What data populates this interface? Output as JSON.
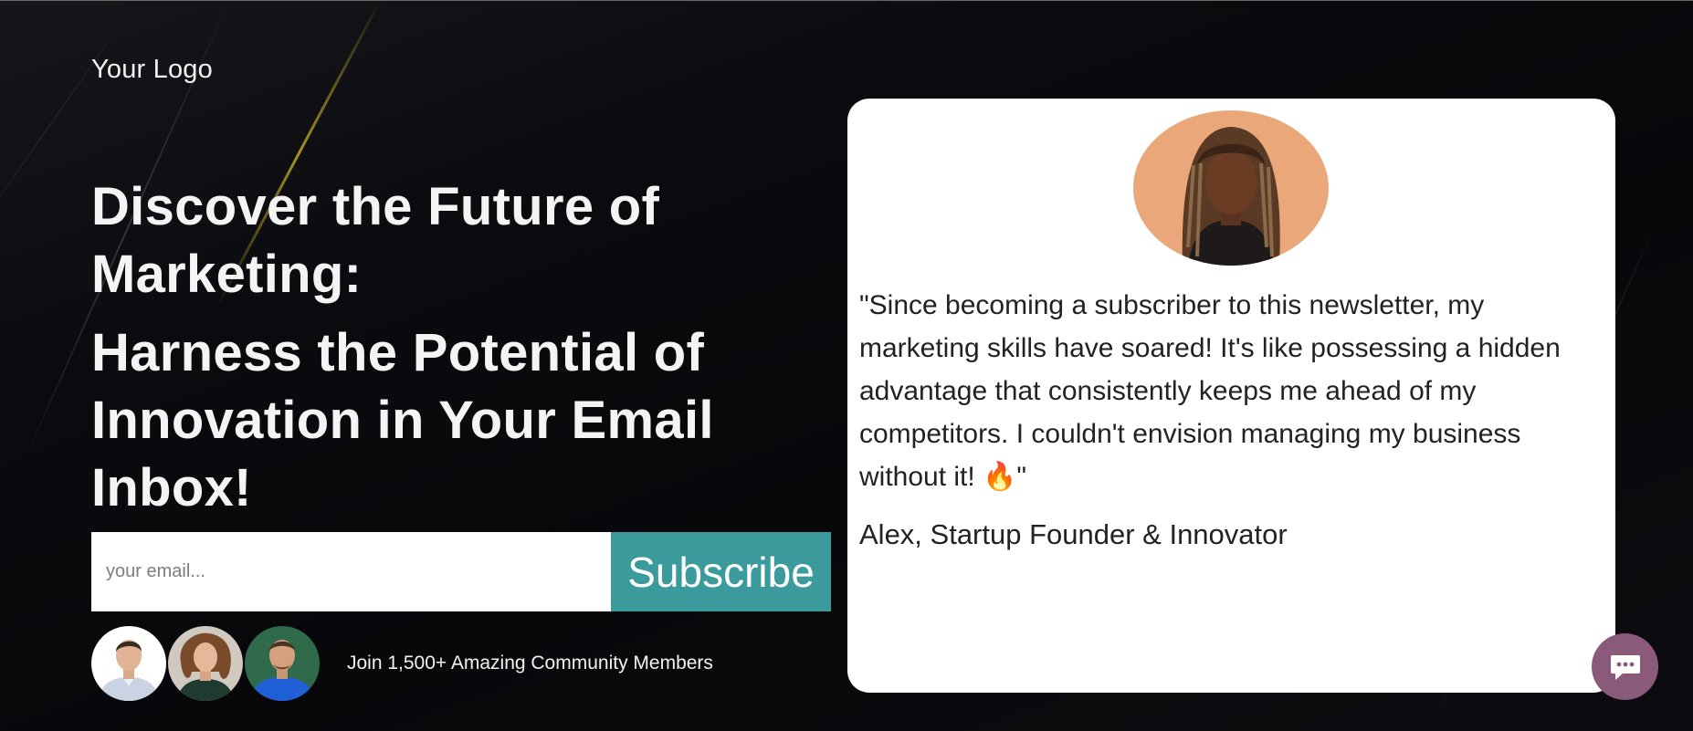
{
  "logo": {
    "text": "Your Logo"
  },
  "hero": {
    "headline": "Discover the Future of Marketing:",
    "subheadline": "Harness the Potential of Innovation in Your Email Inbox!"
  },
  "signup": {
    "email_placeholder": "your email...",
    "subscribe_label": "Subscribe"
  },
  "community": {
    "text": "Join 1,500+ Amazing Community Members",
    "avatars": [
      "member-avatar-1",
      "member-avatar-2",
      "member-avatar-3"
    ]
  },
  "testimonial": {
    "quote_open": "\"Since becoming a subscriber to this newsletter, my marketing skills have soared! It's like possessing a hidden advantage that consistently keeps me ahead of my competitors. I couldn't envision managing my business without it! ",
    "emoji": "🔥",
    "quote_close": "\"",
    "author": "Alex, Startup Founder & Innovator"
  },
  "chat": {
    "icon": "chat-bubble-icon"
  },
  "colors": {
    "background": "#0a0a0d",
    "accent": "#3a9a9c",
    "chat_button": "#8a5a7a",
    "card": "#ffffff"
  }
}
